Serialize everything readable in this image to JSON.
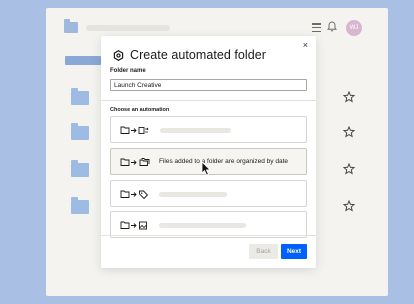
{
  "background_app": {
    "avatar_initials": "WJ",
    "icons": [
      "folder-icon",
      "hamburger-menu-icon",
      "bell-icon",
      "star-icon"
    ],
    "colors": {
      "page_bg": "#a9c0e4",
      "folder_blue": "#9dbbe3",
      "avatar": "#d9b6cf"
    }
  },
  "modal": {
    "title": "Create automated folder",
    "close_glyph": "×",
    "folder_name_label": "Folder name",
    "folder_name_value": "Launch Creative",
    "choose_label": "Choose an automation",
    "options": [
      {
        "icons": [
          "folder-icon",
          "arrow-right-icon",
          "convert-icon"
        ],
        "text": ""
      },
      {
        "icons": [
          "folder-icon",
          "arrow-right-icon",
          "folders-icon"
        ],
        "text": "Files added to a folder are organized by date",
        "selected": true
      },
      {
        "icons": [
          "folder-icon",
          "arrow-right-icon",
          "tag-icon"
        ],
        "text": ""
      },
      {
        "icons": [
          "folder-icon",
          "arrow-right-icon",
          "image-icon"
        ],
        "text": ""
      }
    ],
    "back_label": "Back",
    "next_label": "Next",
    "colors": {
      "primary": "#0061fe",
      "disabled_bg": "#eceae6"
    }
  }
}
